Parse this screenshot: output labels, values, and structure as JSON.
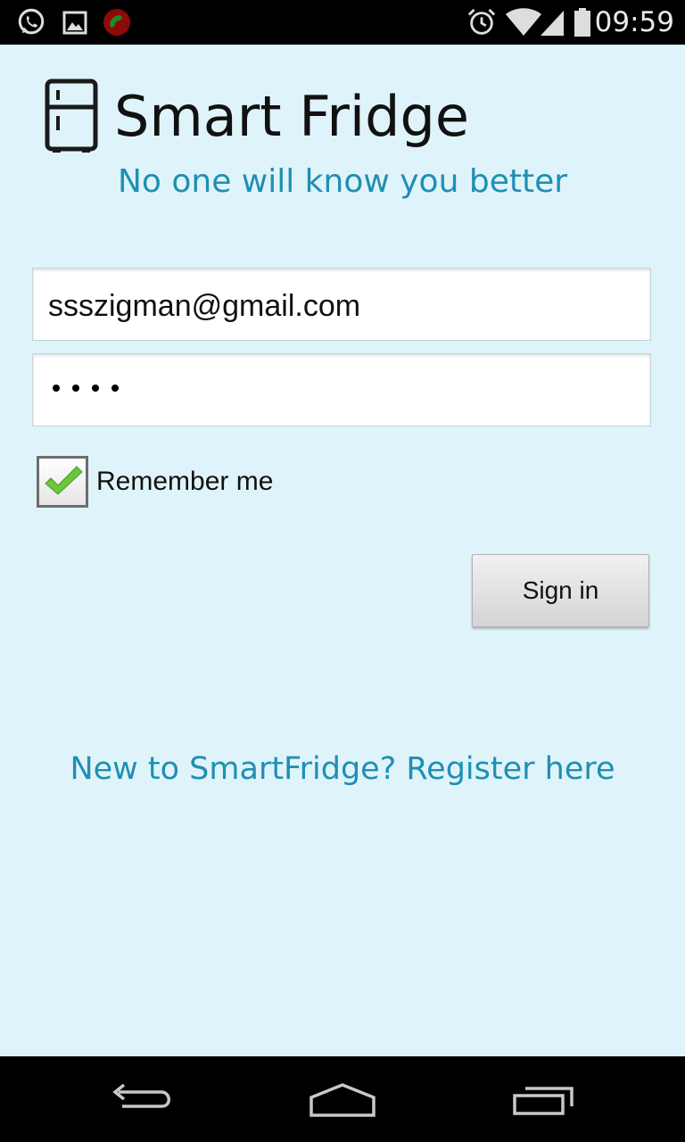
{
  "status_bar": {
    "time": "09:59",
    "left_icons": [
      "whatsapp-icon",
      "gallery-icon",
      "call-recorder-icon"
    ],
    "right_icons": [
      "alarm-icon",
      "wifi-icon",
      "signal-icon",
      "battery-icon"
    ]
  },
  "header": {
    "icon": "fridge-icon",
    "title": "Smart Fridge",
    "tagline": "No one will know you better"
  },
  "form": {
    "email_value": "ssszigman@gmail.com",
    "password_mask": "••••",
    "password_length": 4,
    "remember_label": "Remember me",
    "remember_checked": true,
    "signin_label": "Sign in"
  },
  "register_link": "New to SmartFridge? Register here",
  "nav_bar": {
    "buttons": [
      "back-icon",
      "home-icon",
      "recent-apps-icon"
    ]
  },
  "colors": {
    "background": "#dff4fa",
    "accent": "#1f8fb3",
    "check_green": "#6cc63a"
  }
}
